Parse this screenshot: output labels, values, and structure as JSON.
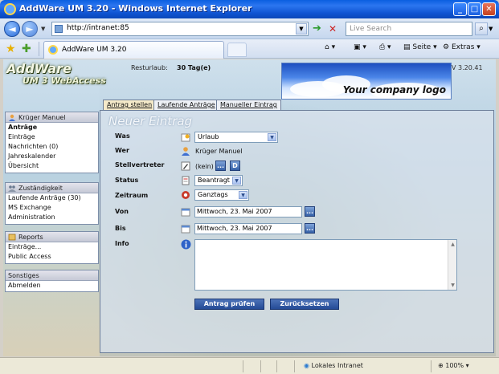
{
  "window": {
    "title": "AddWare UM 3.20 - Windows Internet Explorer"
  },
  "browser": {
    "url": "http://intranet:85",
    "search_placeholder": "Live Search",
    "tab_label": "AddWare UM 3.20",
    "commands": {
      "page": "Seite",
      "tools": "Extras"
    }
  },
  "header": {
    "logo_line1": "AddWare",
    "logo_line2": "UM 3 WebAccess",
    "resturlaub_label": "Resturlaub:",
    "resturlaub_value": "30 Tag(e)",
    "company_logo": "Your company logo",
    "version": "V 3.20.41"
  },
  "sidebar": {
    "user": {
      "title": "Krüger Manuel",
      "items": [
        "Anträge",
        "Einträge",
        "Nachrichten (0)",
        "Jahreskalender",
        "Übersicht"
      ]
    },
    "responsibility": {
      "title": "Zuständigkeit",
      "items": [
        "Laufende Anträge (30)",
        "MS Exchange",
        "Administration"
      ]
    },
    "reports": {
      "title": "Reports",
      "items": [
        "Einträge...",
        "Public Access"
      ]
    },
    "other": {
      "title": "Sonstiges",
      "items": [
        "Abmelden"
      ]
    }
  },
  "tabs": [
    "Antrag stellen",
    "Laufende Anträge",
    "Manueller Eintrag"
  ],
  "form": {
    "title": "Neuer Eintrag",
    "labels": {
      "was": "Was",
      "wer": "Wer",
      "stellvertreter": "Stellvertreter",
      "status": "Status",
      "zeitraum": "Zeitraum",
      "von": "Von",
      "bis": "Bis",
      "info": "Info"
    },
    "values": {
      "was": "Urlaub",
      "wer": "Krüger Manuel",
      "stellvertreter": "(kein)",
      "stellvertreter_btn1": "...",
      "stellvertreter_btn2": "D",
      "status": "Beantragt",
      "zeitraum": "Ganztags",
      "von": "Mittwoch, 23. Mai 2007",
      "bis": "Mittwoch, 23. Mai 2007",
      "date_btn": "...",
      "info": ""
    },
    "buttons": {
      "submit": "Antrag prüfen",
      "reset": "Zurücksetzen"
    }
  },
  "statusbar": {
    "zone": "Lokales Intranet",
    "zoom": "100%"
  }
}
